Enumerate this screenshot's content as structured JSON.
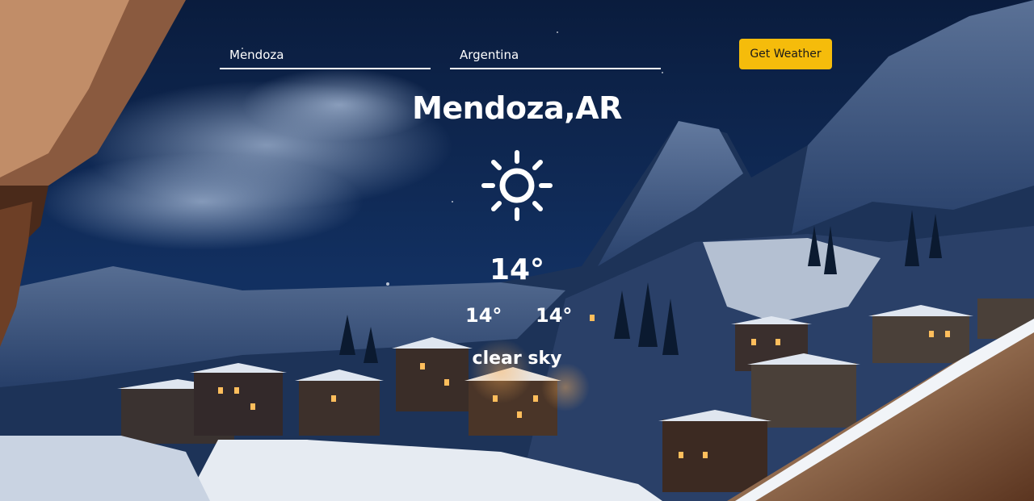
{
  "search": {
    "city_value": "Mendoza",
    "country_value": "Argentina",
    "button_label": "Get Weather"
  },
  "weather": {
    "location": "Mendoza,AR",
    "icon": "sun-icon",
    "temperature": "14°",
    "temp_min": "14°",
    "temp_max": "14°",
    "description": "clear sky"
  },
  "colors": {
    "button": "#f5bc0b",
    "sky": "#0d2346"
  }
}
